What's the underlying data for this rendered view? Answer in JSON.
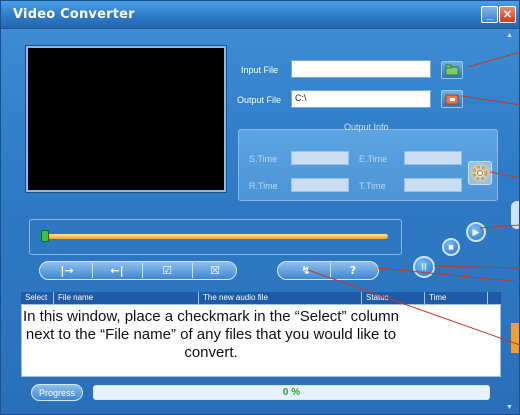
{
  "window": {
    "title": "Video Converter",
    "minimize_glyph": "_",
    "close_glyph": "✕"
  },
  "files": {
    "input_label": "Input File",
    "input_value": "",
    "output_label": "Output File",
    "output_value": "C:\\"
  },
  "output_info": {
    "title": "Output Info",
    "s_time_label": "S.Time",
    "e_time_label": "E.Time",
    "r_time_label": "R.Time",
    "t_time_label": "T.Time",
    "s_time_value": "",
    "e_time_value": "",
    "r_time_value": "",
    "t_time_value": ""
  },
  "controls": {
    "set_start_glyph": "|→",
    "set_end_glyph": "←|",
    "check_glyph": "☑",
    "remove_glyph": "☒",
    "convert_glyph": "↯",
    "help_glyph": "?",
    "play_glyph": "▶",
    "stop_glyph": "■",
    "pause_glyph": "II"
  },
  "seek": {
    "position": 0.0
  },
  "table": {
    "columns": [
      "Select",
      "File name",
      "The new audio file",
      "Status",
      "Time"
    ]
  },
  "caption": "In this window, place a checkmark in the “Select” column next to the “File name” of any files that you would like to convert.",
  "progress": {
    "button_label": "Progress",
    "value": 0,
    "text": "0 %"
  },
  "colors": {
    "window_blue": "#2f7bc6",
    "progress_green": "#3cc24a",
    "callout_red": "#c0392b"
  }
}
